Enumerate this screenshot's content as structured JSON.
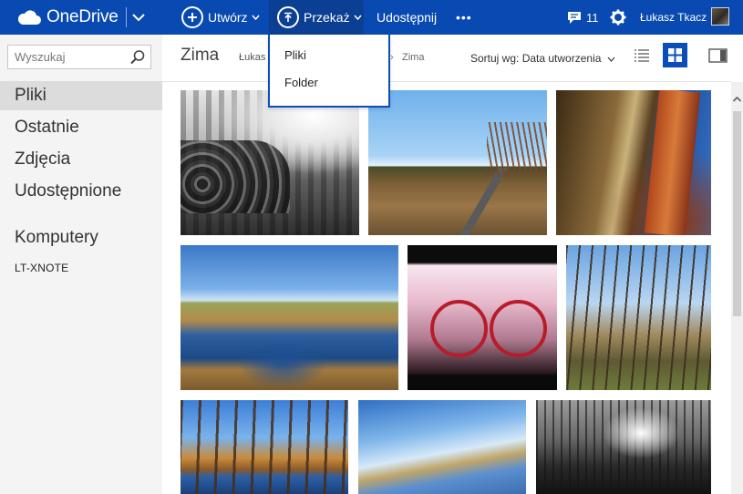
{
  "topbar": {
    "brand": "OneDrive",
    "create_label": "Utwórz",
    "upload_label": "Przekaż",
    "share_label": "Udostępnij",
    "more_label": "•••",
    "notifications_count": "11",
    "user_name": "Łukasz Tkacz"
  },
  "upload_menu": {
    "items": [
      {
        "label": "Pliki"
      },
      {
        "label": "Folder"
      }
    ]
  },
  "search": {
    "placeholder": "Wyszukaj"
  },
  "sidebar": {
    "items": [
      {
        "label": "Pliki",
        "active": true
      },
      {
        "label": "Ostatnie"
      },
      {
        "label": "Zdjęcia"
      },
      {
        "label": "Udostępnione"
      }
    ],
    "computers_label": "Komputery",
    "computer_name": "LT-XNOTE"
  },
  "main": {
    "title": "Zima",
    "breadcrumb_user": "Łukas",
    "breadcrumb_separator": "›",
    "breadcrumb_current": "Zima",
    "sort_label": "Sortuj wg: Data utworzenia"
  },
  "theme": {
    "topbar_bg": "#094ab2",
    "accent": "#0a4fb8",
    "nav_bg": "#f4f4f4",
    "nav_active_bg": "#dcdcdc"
  }
}
